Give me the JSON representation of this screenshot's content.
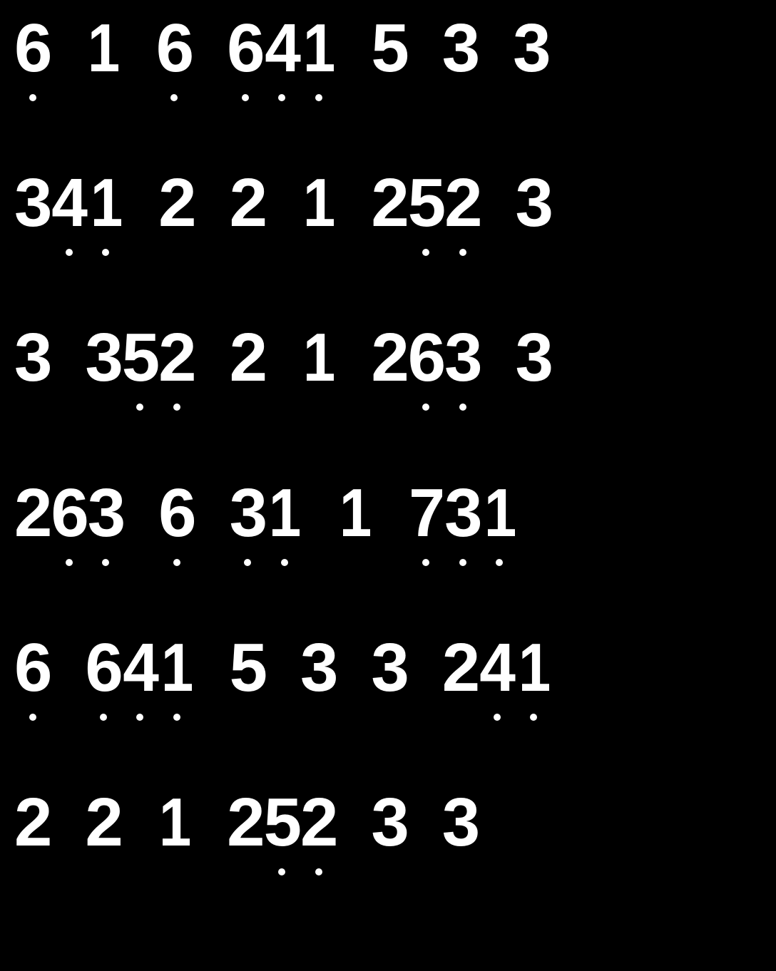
{
  "rows": [
    [
      {
        "digits": [
          {
            "d": "6",
            "dot": true
          }
        ]
      },
      {
        "digits": [
          {
            "d": "1",
            "dot": false
          }
        ]
      },
      {
        "digits": [
          {
            "d": "6",
            "dot": true
          }
        ]
      },
      {
        "digits": [
          {
            "d": "6",
            "dot": true
          },
          {
            "d": "4",
            "dot": true
          },
          {
            "d": "1",
            "dot": true
          }
        ]
      },
      {
        "digits": [
          {
            "d": "5",
            "dot": false
          }
        ]
      },
      {
        "digits": [
          {
            "d": "3",
            "dot": false
          }
        ]
      },
      {
        "digits": [
          {
            "d": "3",
            "dot": false
          }
        ]
      }
    ],
    [
      {
        "digits": [
          {
            "d": "3",
            "dot": false
          },
          {
            "d": "4",
            "dot": true
          },
          {
            "d": "1",
            "dot": true
          }
        ]
      },
      {
        "digits": [
          {
            "d": "2",
            "dot": false
          }
        ]
      },
      {
        "digits": [
          {
            "d": "2",
            "dot": false
          }
        ]
      },
      {
        "digits": [
          {
            "d": "1",
            "dot": false
          }
        ]
      },
      {
        "digits": [
          {
            "d": "2",
            "dot": false
          },
          {
            "d": "5",
            "dot": true
          },
          {
            "d": "2",
            "dot": true
          }
        ]
      },
      {
        "digits": [
          {
            "d": "3",
            "dot": false
          }
        ]
      }
    ],
    [
      {
        "digits": [
          {
            "d": "3",
            "dot": false
          }
        ]
      },
      {
        "digits": [
          {
            "d": "3",
            "dot": false
          },
          {
            "d": "5",
            "dot": true
          },
          {
            "d": "2",
            "dot": true
          }
        ]
      },
      {
        "digits": [
          {
            "d": "2",
            "dot": false
          }
        ]
      },
      {
        "digits": [
          {
            "d": "1",
            "dot": false
          }
        ]
      },
      {
        "digits": [
          {
            "d": "2",
            "dot": false
          },
          {
            "d": "6",
            "dot": true
          },
          {
            "d": "3",
            "dot": true
          }
        ]
      },
      {
        "digits": [
          {
            "d": "3",
            "dot": false
          }
        ]
      }
    ],
    [
      {
        "digits": [
          {
            "d": "2",
            "dot": false
          },
          {
            "d": "6",
            "dot": true
          },
          {
            "d": "3",
            "dot": true
          }
        ]
      },
      {
        "digits": [
          {
            "d": "6",
            "dot": true
          }
        ]
      },
      {
        "digits": [
          {
            "d": "3",
            "dot": true
          },
          {
            "d": "1",
            "dot": true
          }
        ]
      },
      {
        "digits": [
          {
            "d": "1",
            "dot": false
          }
        ]
      },
      {
        "digits": [
          {
            "d": "7",
            "dot": true
          },
          {
            "d": "3",
            "dot": true
          },
          {
            "d": "1",
            "dot": true
          }
        ]
      }
    ],
    [
      {
        "digits": [
          {
            "d": "6",
            "dot": true
          }
        ]
      },
      {
        "digits": [
          {
            "d": "6",
            "dot": true
          },
          {
            "d": "4",
            "dot": true
          },
          {
            "d": "1",
            "dot": true
          }
        ]
      },
      {
        "digits": [
          {
            "d": "5",
            "dot": false
          }
        ]
      },
      {
        "digits": [
          {
            "d": "3",
            "dot": false
          }
        ]
      },
      {
        "digits": [
          {
            "d": "3",
            "dot": false
          }
        ]
      },
      {
        "digits": [
          {
            "d": "2",
            "dot": false
          },
          {
            "d": "4",
            "dot": true
          },
          {
            "d": "1",
            "dot": true
          }
        ]
      }
    ],
    [
      {
        "digits": [
          {
            "d": "2",
            "dot": false
          }
        ]
      },
      {
        "digits": [
          {
            "d": "2",
            "dot": false
          }
        ]
      },
      {
        "digits": [
          {
            "d": "1",
            "dot": false
          }
        ]
      },
      {
        "digits": [
          {
            "d": "2",
            "dot": false
          },
          {
            "d": "5",
            "dot": true
          },
          {
            "d": "2",
            "dot": true
          }
        ]
      },
      {
        "digits": [
          {
            "d": "3",
            "dot": false
          }
        ]
      },
      {
        "digits": [
          {
            "d": "3",
            "dot": false
          }
        ]
      }
    ]
  ]
}
